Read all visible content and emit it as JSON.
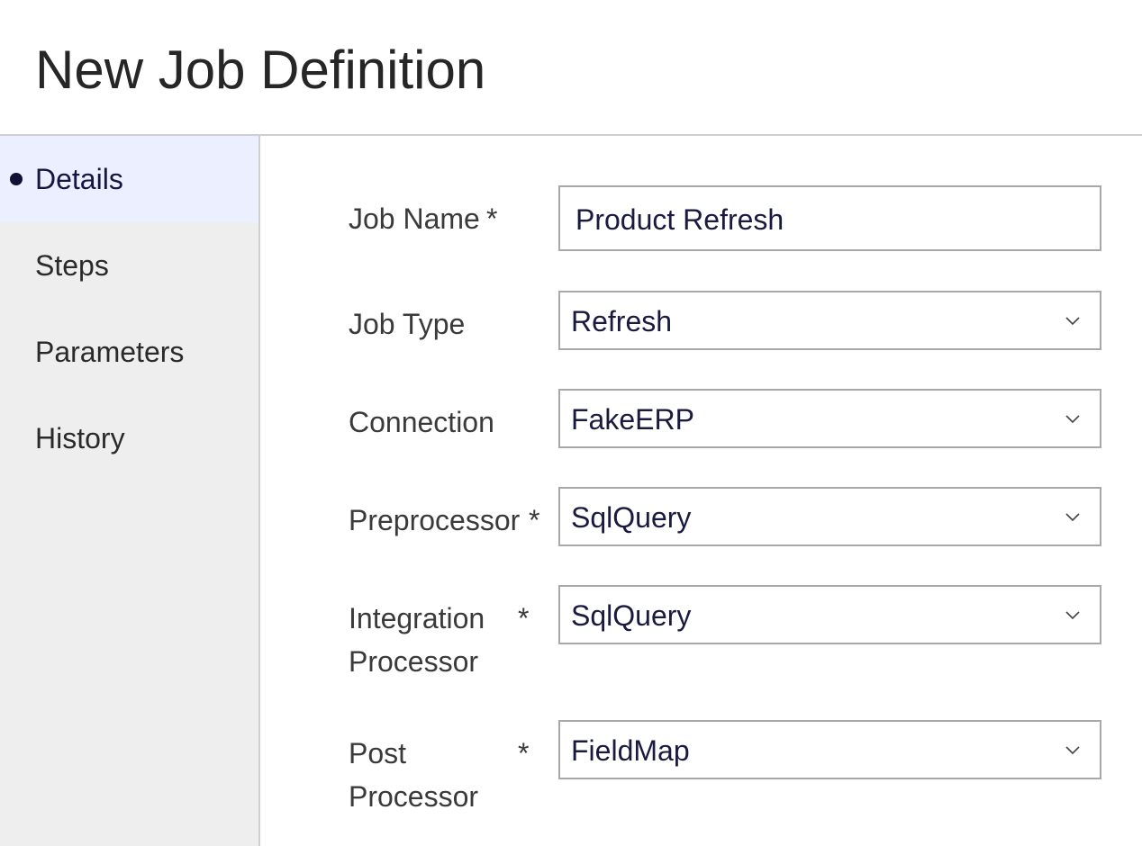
{
  "page": {
    "title": "New Job Definition"
  },
  "sidebar": {
    "items": [
      {
        "label": "Details",
        "active": true
      },
      {
        "label": "Steps",
        "active": false
      },
      {
        "label": "Parameters",
        "active": false
      },
      {
        "label": "History",
        "active": false
      }
    ]
  },
  "form": {
    "job_name": {
      "label": "Job Name",
      "required": "*",
      "value": "Product Refresh"
    },
    "job_type": {
      "label": "Job Type",
      "value": "Refresh"
    },
    "connection": {
      "label": "Connection",
      "value": "FakeERP"
    },
    "preprocessor": {
      "label": "Preprocessor",
      "required": "*",
      "value": "SqlQuery"
    },
    "integration_processor": {
      "label_line1": "Integration",
      "label_line2": "Processor",
      "required": "*",
      "value": "SqlQuery"
    },
    "post_processor": {
      "label_line1": "Post",
      "label_line2": "Processor",
      "required": "*",
      "value": "FieldMap"
    }
  },
  "icons": {
    "select_chevron": "chevron-down-icon",
    "active_nav_marker": "bullet-icon"
  },
  "colors": {
    "active_nav_background": "#ebefff",
    "sidebar_background": "#eeeeee",
    "input_border": "#a8a8a8",
    "value_text": "#1a1a40"
  }
}
